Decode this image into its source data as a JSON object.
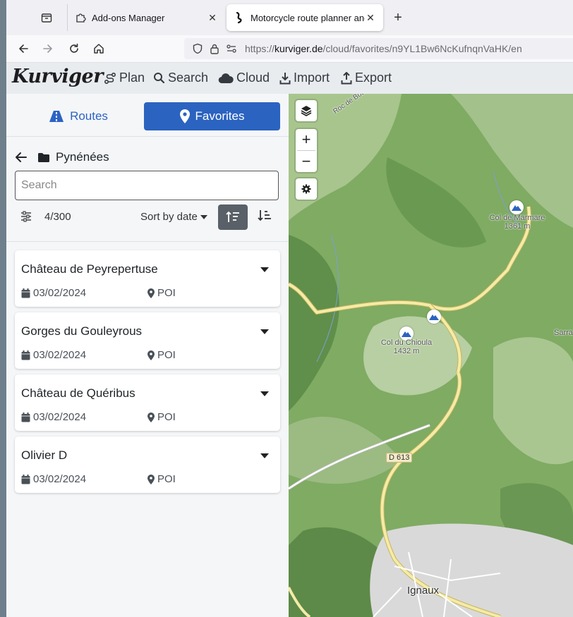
{
  "browser": {
    "tabs": [
      {
        "title": "Add-ons Manager",
        "icon": "puzzle-icon"
      },
      {
        "title": "Motorcycle route planner and n",
        "icon": "kurviger-icon",
        "active": true
      }
    ],
    "url_prefix": "https://",
    "url_host": "kurviger.de",
    "url_path": "/cloud/favorites/n9YL1Bw6NcKufnqnVaHK/en"
  },
  "app": {
    "logo": "Kurviger",
    "menu": {
      "plan": "Plan",
      "search": "Search",
      "cloud": "Cloud",
      "import": "Import",
      "export": "Export"
    }
  },
  "panel": {
    "tabs": {
      "routes": "Routes",
      "favorites": "Favorites"
    },
    "folder": "Pynénées",
    "search_placeholder": "Search",
    "count": "4/300",
    "sort_label": "Sort by date",
    "items": [
      {
        "title": "Château de Peyrepertuse",
        "date": "03/02/2024",
        "type": "POI"
      },
      {
        "title": "Gorges du Gouleyrous",
        "date": "03/02/2024",
        "type": "POI"
      },
      {
        "title": "Château de Quéribus",
        "date": "03/02/2024",
        "type": "POI"
      },
      {
        "title": "Olivier D",
        "date": "03/02/2024",
        "type": "POI"
      }
    ]
  },
  "map": {
    "labels": {
      "col_marmare": "Col de Marmare",
      "col_marmare_alt": "1361 m",
      "col_chioula": "Col du Chioula",
      "col_chioula_alt": "1432 m",
      "road_d613": "D 613",
      "town": "Ignaux",
      "road_top": "Roc de Bou",
      "edge": "Sarra"
    }
  }
}
